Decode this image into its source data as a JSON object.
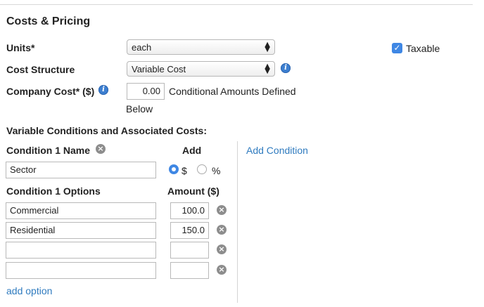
{
  "section": {
    "title": "Costs & Pricing"
  },
  "units": {
    "label": "Units*",
    "value": "each"
  },
  "taxable": {
    "label": "Taxable",
    "checked": true
  },
  "cost_structure": {
    "label": "Cost Structure",
    "value": "Variable Cost"
  },
  "company_cost": {
    "label": "Company Cost* ($)",
    "value": "0.00",
    "note_line1": "Conditional Amounts Defined",
    "note_line2": "Below"
  },
  "variable": {
    "heading": "Variable Conditions and Associated Costs:",
    "condition_name_label": "Condition 1 Name",
    "add_label": "Add",
    "add_condition_link": "Add Condition",
    "condition_name_value": "Sector",
    "add_type": {
      "dollar": "$",
      "percent": "%",
      "selected": "$"
    },
    "options_label": "Condition 1 Options",
    "amount_label": "Amount ($)",
    "options": [
      {
        "name": "Commercial",
        "amount": "100.0"
      },
      {
        "name": "Residential",
        "amount": "150.0"
      },
      {
        "name": "",
        "amount": ""
      },
      {
        "name": "",
        "amount": ""
      }
    ],
    "add_option_link": "add option"
  },
  "icons": {
    "info": "info-icon",
    "remove": "close-circle-icon",
    "check": "checkmark-icon",
    "select_arrows": "updown-arrows-icon"
  },
  "colors": {
    "link": "#2f7bbf",
    "checkbox": "#3f87e4",
    "info": "#3d7fd0"
  }
}
